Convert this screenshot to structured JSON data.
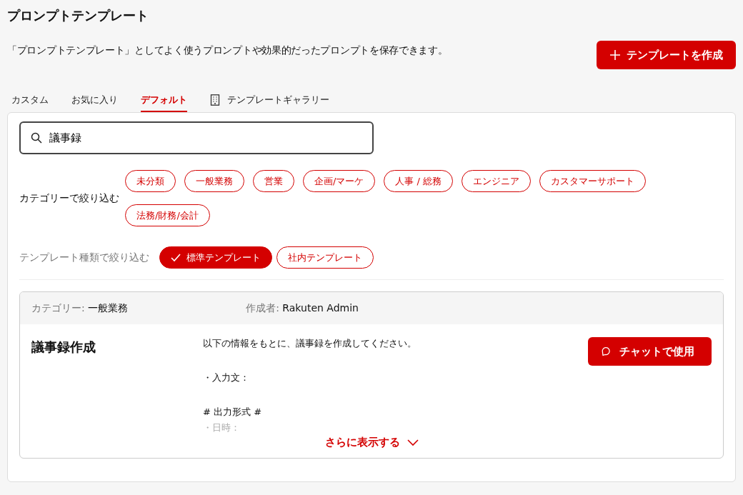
{
  "page": {
    "title": "プロンプトテンプレート",
    "description": "「プロンプトテンプレート」としてよく使うプロンプトや効果的だったプロンプトを保存できます。",
    "create_button": "テンプレートを作成"
  },
  "tabs": [
    {
      "label": "カスタム",
      "selected": false,
      "kind": "text"
    },
    {
      "label": "お気に入り",
      "selected": false,
      "kind": "text"
    },
    {
      "label": "デフォルト",
      "selected": true,
      "kind": "text"
    },
    {
      "label": "テンプレートギャラリー",
      "selected": false,
      "kind": "gallery"
    }
  ],
  "search": {
    "value": "議事録"
  },
  "category_filter": {
    "label": "カテゴリーで絞り込む",
    "chips": [
      {
        "label": "未分類",
        "selected": false
      },
      {
        "label": "一般業務",
        "selected": false
      },
      {
        "label": "営業",
        "selected": false
      },
      {
        "label": "企画/マーケ",
        "selected": false
      },
      {
        "label": "人事 / 総務",
        "selected": false
      },
      {
        "label": "エンジニア",
        "selected": false
      },
      {
        "label": "カスタマーサポート",
        "selected": false
      },
      {
        "label": "法務/財務/会計",
        "selected": false
      }
    ]
  },
  "type_filter": {
    "label": "テンプレート種類で絞り込む",
    "chips": [
      {
        "label": "標準テンプレート",
        "selected": true
      },
      {
        "label": "社内テンプレート",
        "selected": false
      }
    ]
  },
  "templates": [
    {
      "category_label": "カテゴリー:",
      "category": "一般業務",
      "author_label": "作成者:",
      "author": "Rakuten Admin",
      "title": "議事録作成",
      "prompt_lines": [
        {
          "text": "以下の情報をもとに、議事録を作成してください。",
          "faded": false
        },
        {
          "text": "・入力文：",
          "faded": false
        },
        {
          "text": "# 出力形式 #",
          "faded": false
        },
        {
          "text": "・日時：",
          "faded": true
        }
      ],
      "use_button": "チャットで使用",
      "more_link": "さらに表示する"
    }
  ]
}
